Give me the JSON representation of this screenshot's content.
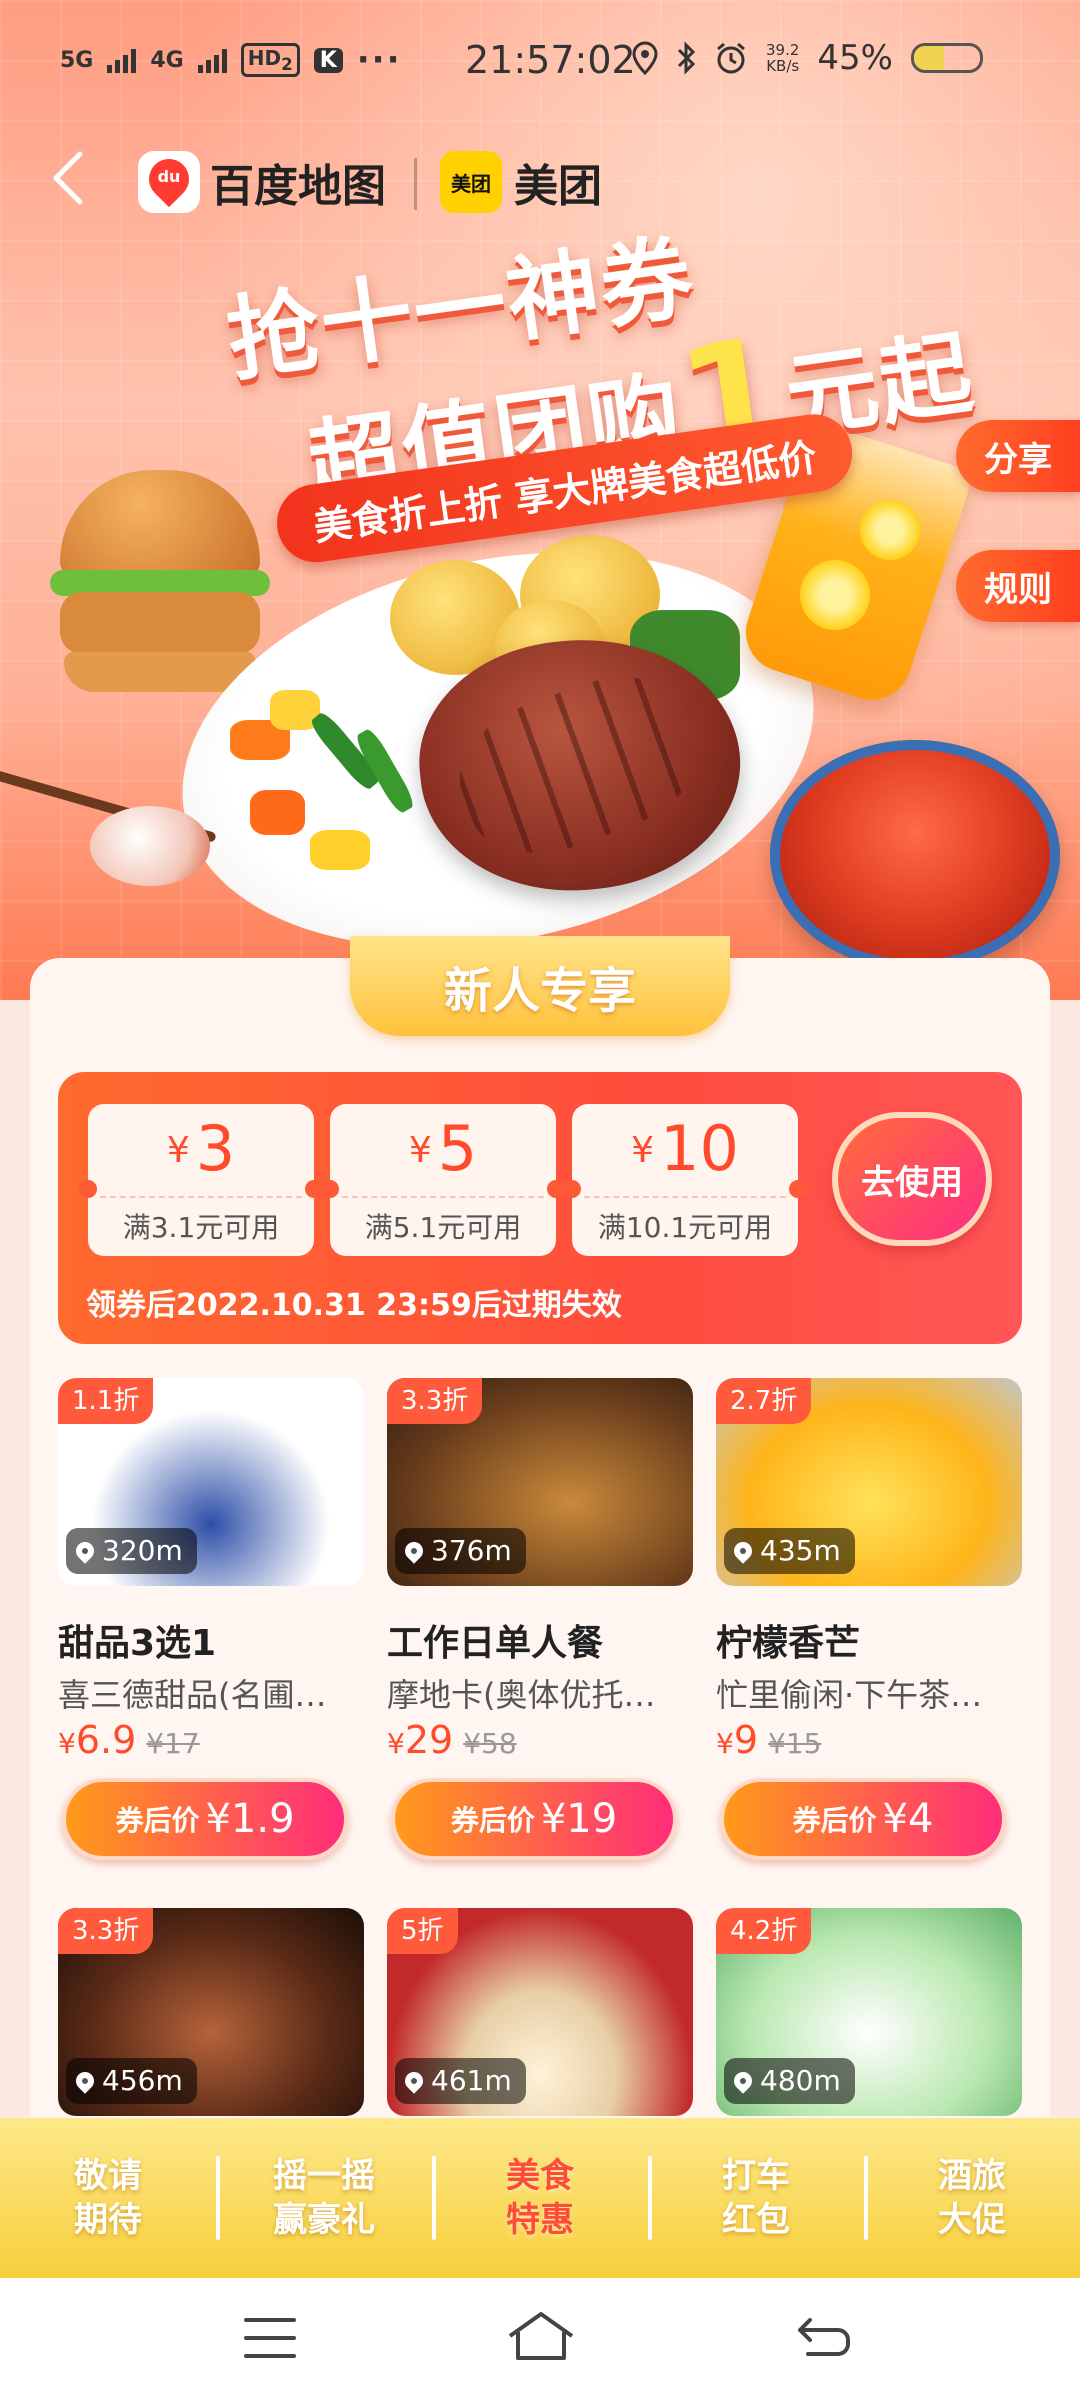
{
  "status_bar": {
    "net1": "5G",
    "net2": "4G",
    "hd": "HD",
    "hd_sub": "2",
    "app_badge": "K",
    "more": "···",
    "time": "21:57:02",
    "speed_value": "39.2",
    "speed_unit": "KB/s",
    "battery": "45%",
    "battery_level": 0.45
  },
  "header": {
    "baidu_logo_text": "du",
    "baidu_name": "百度地图",
    "meituan_logo_text": "美团",
    "meituan_name": "美团"
  },
  "hero": {
    "headline_1": "抢十一神券",
    "headline_2_a": "超值团购",
    "headline_2_big": "1",
    "headline_2_b": "元起",
    "subtitle": "美食折上折 享大牌美食超低价",
    "share_label": "分享",
    "rules_label": "规则"
  },
  "newcomer": {
    "tab_label": "新人专享",
    "coupons": [
      {
        "yen": "¥",
        "amount": "3",
        "condition": "满3.1元可用"
      },
      {
        "yen": "¥",
        "amount": "5",
        "condition": "满5.1元可用"
      },
      {
        "yen": "¥",
        "amount": "10",
        "condition": "满10.1元可用"
      }
    ],
    "use_button": "去使用",
    "expire_note": "领券后2022.10.31 23:59后过期失效"
  },
  "products": [
    {
      "discount": "1.1折",
      "distance": "320m",
      "title": "甜品3选1",
      "shop": "喜三德甜品(名圃…",
      "yen": "¥",
      "price": "6.9",
      "orig": "¥17",
      "btn_label": "券后价",
      "btn_price": "¥1.9"
    },
    {
      "discount": "3.3折",
      "distance": "376m",
      "title": "工作日单人餐",
      "shop": "摩地卡(奥体优托…",
      "yen": "¥",
      "price": "29",
      "orig": "¥58",
      "btn_label": "券后价",
      "btn_price": "¥19"
    },
    {
      "discount": "2.7折",
      "distance": "435m",
      "title": "柠檬香芒",
      "shop": "忙里偷闲·下午茶…",
      "yen": "¥",
      "price": "9",
      "orig": "¥15",
      "btn_label": "券后价",
      "btn_price": "¥4"
    },
    {
      "discount": "3.3折",
      "distance": "456m"
    },
    {
      "discount": "5折",
      "distance": "461m"
    },
    {
      "discount": "4.2折",
      "distance": "480m"
    }
  ],
  "activity_bar": [
    {
      "line1": "敬请",
      "line2": "期待",
      "active": false
    },
    {
      "line1": "摇一摇",
      "line2": "赢豪礼",
      "active": false
    },
    {
      "line1": "美食",
      "line2": "特惠",
      "active": true
    },
    {
      "line1": "打车",
      "line2": "红包",
      "active": false
    },
    {
      "line1": "酒旅",
      "line2": "大促",
      "active": false
    }
  ],
  "colors": {
    "accent": "#ff4b2b",
    "gold": "#ffc13b",
    "activity_bar": "#f8cf3c"
  }
}
